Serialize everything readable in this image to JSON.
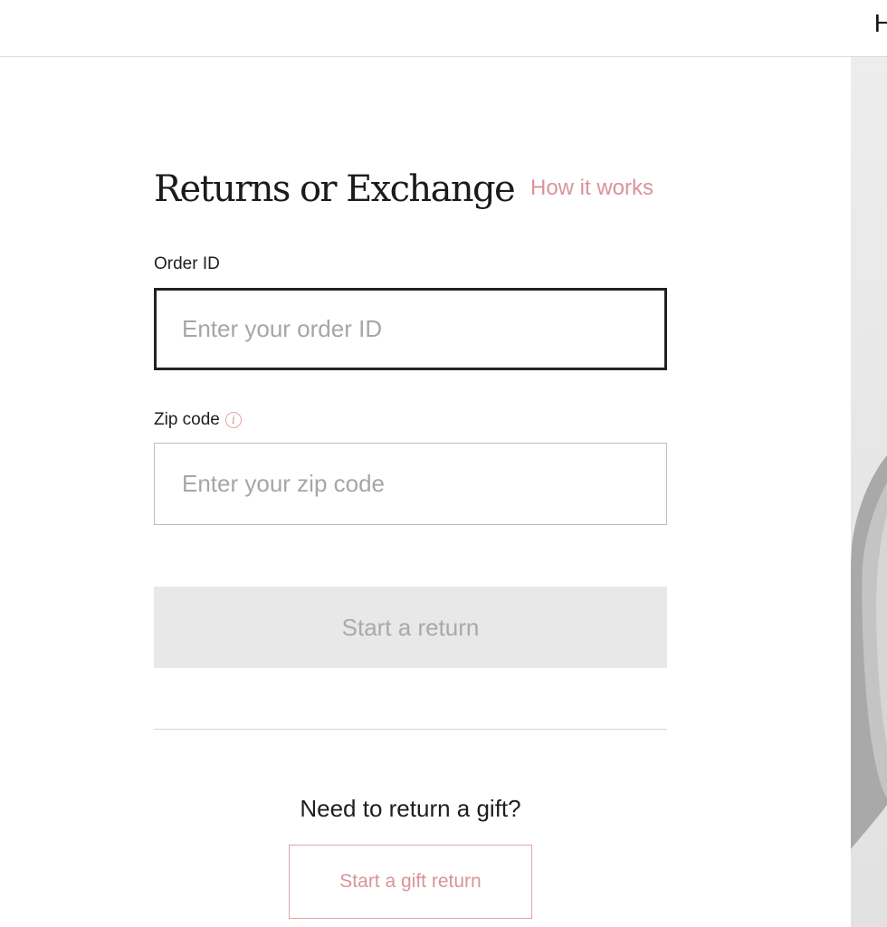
{
  "header": {
    "partial_text": "H"
  },
  "form": {
    "title": "Returns or Exchange",
    "how_it_works_link": "How it works",
    "order_id": {
      "label": "Order ID",
      "placeholder": "Enter your order ID",
      "value": ""
    },
    "zip_code": {
      "label": "Zip code",
      "info_icon": "info-icon",
      "info_glyph": "i",
      "placeholder": "Enter your zip code",
      "value": ""
    },
    "submit_label": "Start a return"
  },
  "gift": {
    "heading": "Need to return a gift?",
    "button_label": "Start a gift return"
  },
  "colors": {
    "accent_pink": "#d9939a",
    "border_dark": "#222222",
    "disabled_bg": "#e8e8e8",
    "disabled_text": "#a9a9a9"
  }
}
